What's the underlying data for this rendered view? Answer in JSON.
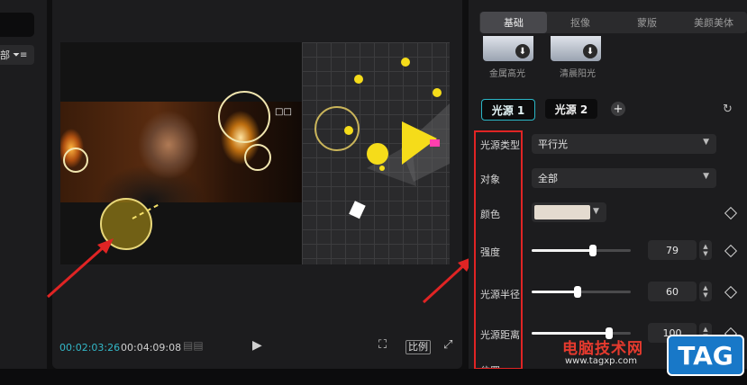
{
  "left_panel": {
    "filter_label": "部",
    "filter_icon": "filter-icon"
  },
  "player": {
    "overlay_text": "□□",
    "time_current": "00:02:03:26",
    "time_total": "00:04:09:08",
    "ratio_label": "比例"
  },
  "right_panel": {
    "tabs": [
      "基础",
      "抠像",
      "蒙版",
      "美颜美体"
    ],
    "active_tab": "基础",
    "presets": [
      {
        "label": "金属高光"
      },
      {
        "label": "清晨阳光"
      }
    ],
    "light_sources": [
      "光源 1",
      "光源 2"
    ],
    "active_source": "光源 1",
    "props": {
      "type": {
        "label": "光源类型",
        "value": "平行光"
      },
      "target": {
        "label": "对象",
        "value": "全部"
      },
      "color": {
        "label": "颜色",
        "value": "#e4dbcf"
      },
      "intensity": {
        "label": "强度",
        "value": "79",
        "level": 0.79
      },
      "radius": {
        "label": "光源半径",
        "value": "60",
        "level": 0.6
      },
      "distance": {
        "label": "光源距离",
        "value": "100",
        "level": 1.0
      },
      "position": {
        "label": "位置"
      }
    }
  },
  "watermark": {
    "text": "电脑技术网",
    "url": "www.tagxp.com",
    "logo": "TAG"
  },
  "colors": {
    "accent": "#2bb6c6",
    "highlight": "#e02424",
    "light": "#f5dc1a"
  }
}
